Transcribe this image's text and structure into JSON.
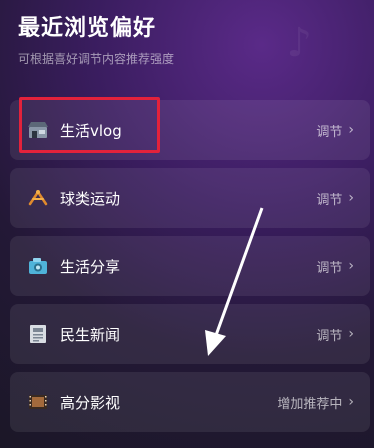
{
  "header": {
    "title": "最近浏览偏好",
    "subtitle": "可根据喜好调节内容推荐强度"
  },
  "items": [
    {
      "label": "生活vlog",
      "action": "调节",
      "icon": "storefront-icon"
    },
    {
      "label": "球类运动",
      "action": "调节",
      "icon": "sports-icon"
    },
    {
      "label": "生活分享",
      "action": "调节",
      "icon": "camera-icon"
    },
    {
      "label": "民生新闻",
      "action": "调节",
      "icon": "newspaper-icon"
    },
    {
      "label": "高分影视",
      "action": "增加推荐中",
      "icon": "film-icon"
    }
  ],
  "colors": {
    "highlight": "#e3223b",
    "background": "#3a1d5f"
  }
}
